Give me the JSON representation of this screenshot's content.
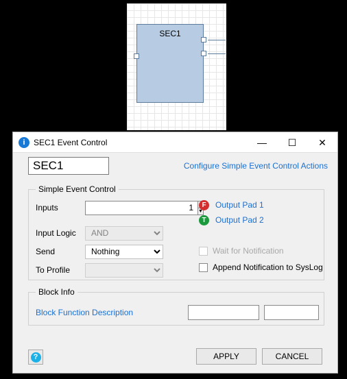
{
  "diagram": {
    "block_label": "SEC1"
  },
  "dialog": {
    "title": "SEC1 Event Control",
    "block_name": "SEC1",
    "config_link": "Configure Simple Event Control Actions",
    "sec_group_label": "Simple Event Control",
    "inputs_label": "Inputs",
    "inputs_value": "1",
    "input_logic_label": "Input Logic",
    "input_logic_value": "AND",
    "send_label": "Send",
    "send_value": "Nothing",
    "to_profile_label": "To Profile",
    "to_profile_value": "",
    "output_pad_1": "Output Pad 1",
    "output_pad_2": "Output Pad 2",
    "wait_label": "Wait for Notification",
    "append_label": "Append Notification to SysLog",
    "block_info_label": "Block Info",
    "bfd_link": "Block Function Description",
    "apply_label": "APPLY",
    "cancel_label": "CANCEL"
  }
}
